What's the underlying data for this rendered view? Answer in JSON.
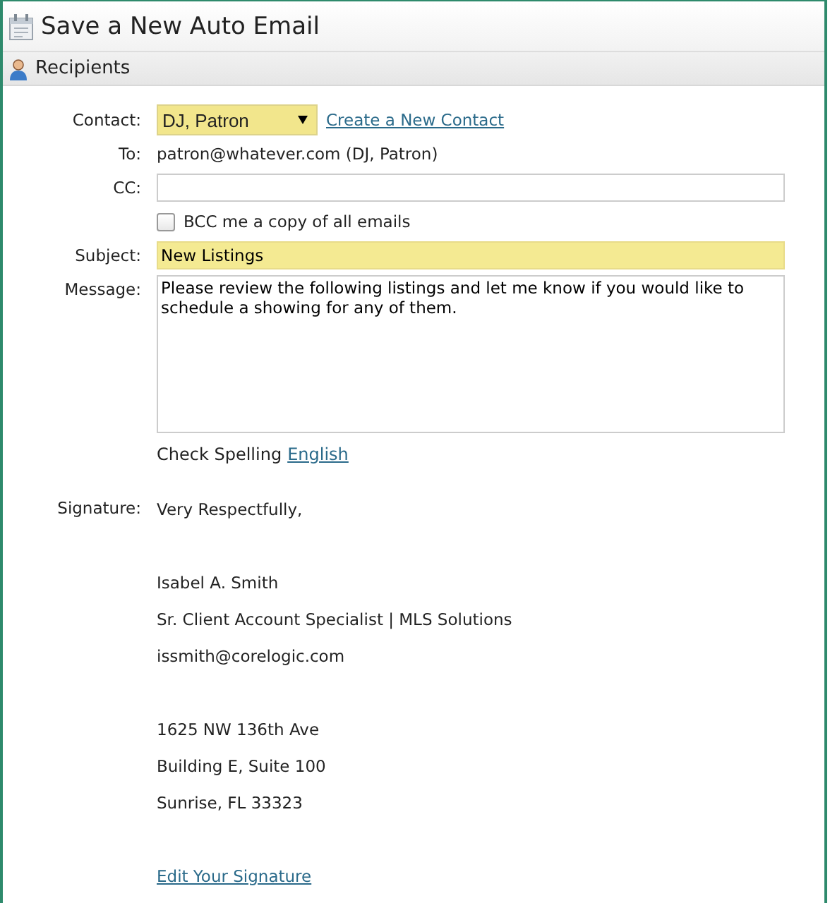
{
  "window": {
    "title": "Save a New Auto Email"
  },
  "section": {
    "title": "Recipients"
  },
  "form": {
    "contact": {
      "label": "Contact:",
      "value": "DJ, Patron",
      "link": "Create a New Contact"
    },
    "to": {
      "label": "To:",
      "value": "patron@whatever.com (DJ, Patron)"
    },
    "cc": {
      "label": "CC:"
    },
    "bcc": {
      "label": "BCC me a copy of all emails",
      "checked": false
    },
    "subject": {
      "label": "Subject:",
      "value": "New Listings"
    },
    "message": {
      "label": "Message:",
      "value": "Please review the following listings and let me know if you would like to schedule a showing for any of them."
    },
    "spelling": {
      "label": "Check Spelling",
      "link": "English"
    },
    "signature": {
      "label": "Signature:",
      "paragraphs": [
        [
          "Very Respectfully,"
        ],
        [
          "Isabel A. Smith",
          "Sr. Client Account Specialist | MLS Solutions",
          "issmith@corelogic.com"
        ],
        [
          "1625 NW 136th Ave",
          "Building E, Suite 100",
          "Sunrise, FL 33323"
        ]
      ],
      "edit_link": "Edit Your Signature"
    }
  }
}
